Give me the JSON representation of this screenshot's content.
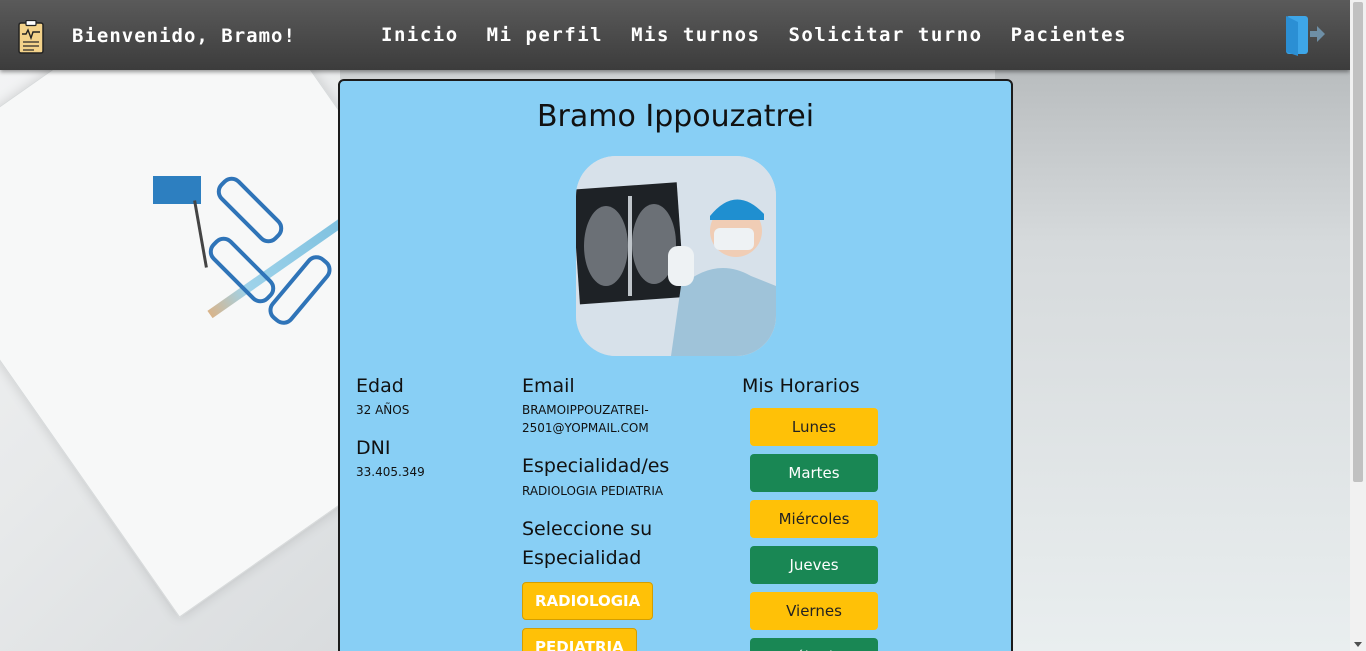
{
  "navbar": {
    "welcome": "Bienvenido, Bramo!",
    "links": [
      "Inicio",
      "Mi perfil",
      "Mis turnos",
      "Solicitar turno",
      "Pacientes"
    ],
    "logo_icon": "clipboard-icon",
    "logout_icon": "logout-icon"
  },
  "profile": {
    "name": "Bramo Ippouzatrei",
    "photo": "doctor-xray-photo",
    "edad_label": "Edad",
    "edad_value": "32 años",
    "dni_label": "DNI",
    "dni_value": "33.405.349",
    "email_label": "Email",
    "email_value_line1": "bramoippouzatrei-",
    "email_value_line2": "2501@yopmail.com",
    "especialidad_label": "Especialidad/es",
    "especialidad_value": "Radiologia pediatria",
    "seleccione_line1": "Seleccione su",
    "seleccione_line2": "Especialidad",
    "specialties": [
      "RADIOLOGIA",
      "PEDIATRIA"
    ],
    "horarios_label": "Mis Horarios",
    "days": [
      "Lunes",
      "Martes",
      "Miércoles",
      "Jueves",
      "Viernes",
      "Sábado"
    ]
  },
  "colors": {
    "card_bg": "#88cff5",
    "yellow": "#ffc107",
    "green": "#198754",
    "navbar": "#4a4a4a"
  }
}
